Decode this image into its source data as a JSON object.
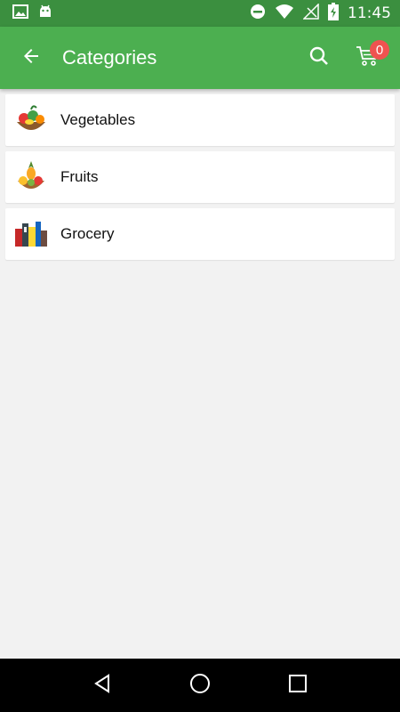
{
  "status_bar": {
    "time": "11:45",
    "icons": [
      "image-icon",
      "android-icon",
      "do-not-disturb-icon",
      "wifi-icon",
      "no-signal-icon",
      "battery-charging-icon"
    ]
  },
  "app_bar": {
    "title": "Categories",
    "back_icon": "arrow-back-icon",
    "search_icon": "search-icon",
    "cart_icon": "cart-icon",
    "cart_count": "0"
  },
  "categories": [
    {
      "label": "Vegetables",
      "icon": "vegetables-thumbnail"
    },
    {
      "label": "Fruits",
      "icon": "fruits-thumbnail"
    },
    {
      "label": "Grocery",
      "icon": "grocery-thumbnail"
    }
  ],
  "nav_bar": {
    "icons": [
      "back-triangle-icon",
      "home-circle-icon",
      "recents-square-icon"
    ]
  },
  "colors": {
    "status_bar": "#3b8f3f",
    "app_bar": "#4caf50",
    "badge": "#ef5350",
    "background": "#f2f2f2"
  }
}
